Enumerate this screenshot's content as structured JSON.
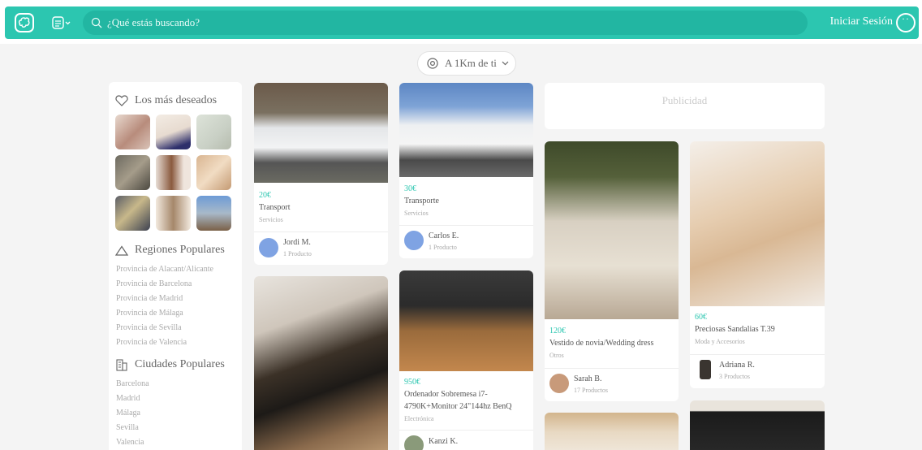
{
  "header": {
    "search_placeholder": "¿Qué estás buscando?",
    "login_label": "Iniciar Sesión"
  },
  "location": {
    "label": "A 1Km de ti"
  },
  "sidebar": {
    "wishlist_title": "Los más deseados",
    "regions_title": "Regiones Populares",
    "regions": [
      "Provincia de Alacant/Alicante",
      "Provincia de Barcelona",
      "Provincia de Madrid",
      "Provincia de Málaga",
      "Provincia de Sevilla",
      "Provincia de Valencia"
    ],
    "cities_title": "Ciudades Populares",
    "cities": [
      "Barcelona",
      "Madrid",
      "Málaga",
      "Sevilla",
      "Valencia"
    ]
  },
  "ad": {
    "label": "Publicidad"
  },
  "products": [
    {
      "price": "20€",
      "title": "Transport",
      "category": "Servicios",
      "user": "Jordi M.",
      "count": "1 Producto"
    },
    {
      "price": "30€",
      "title": "Transporte",
      "category": "Servicios",
      "user": "Carlos E.",
      "count": "1 Producto"
    },
    {
      "price": "950€",
      "title": "Ordenador Sobremesa i7-4790K+Monitor 24\"144hz BenQ",
      "category": "Electrónica",
      "user": "Kanzi K.",
      "count": ""
    },
    {
      "price": "120€",
      "title": "Vestido de novia/Wedding dress",
      "category": "Otros",
      "user": "Sarah B.",
      "count": "17 Productos"
    },
    {
      "price": "60€",
      "title": "Preciosas Sandalias T.39",
      "category": "Moda y Accesorios",
      "user": "Adriana R.",
      "count": "3 Productos"
    }
  ],
  "colors": {
    "accent": "#2cc6b0",
    "background": "#f4f4f4"
  }
}
